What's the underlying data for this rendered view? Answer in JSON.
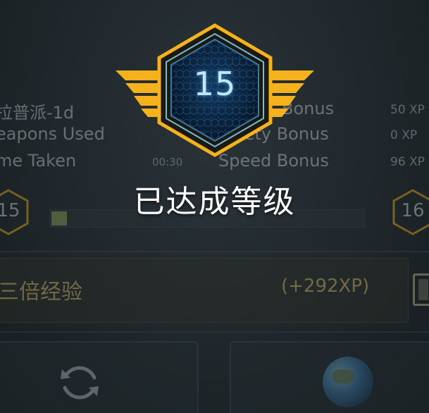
{
  "levelup": {
    "level": "15",
    "title": "已达成等级"
  },
  "stats": [
    {
      "left": "拉普派-1d",
      "time": "",
      "bonus": "Bonus",
      "xp": "50 XP"
    },
    {
      "left": "eapons Used",
      "time": "",
      "bonus": "iety Bonus",
      "xp": "0 XP"
    },
    {
      "left": "me Taken",
      "time": "00:30",
      "bonus": "Speed Bonus",
      "xp": "96 XP"
    }
  ],
  "progress": {
    "current_level": "15",
    "next_level": "16",
    "fill_fraction": 0.05
  },
  "double_xp": {
    "label": "三倍经验",
    "amount": "(+292XP)"
  },
  "buttons": {
    "left_icon": "refresh-icon",
    "right_icon": "globe-icon"
  },
  "colors": {
    "gold": "#f5b21c",
    "badge_blue": "#bfe8ff",
    "xp_yellow": "#e6c66b"
  }
}
